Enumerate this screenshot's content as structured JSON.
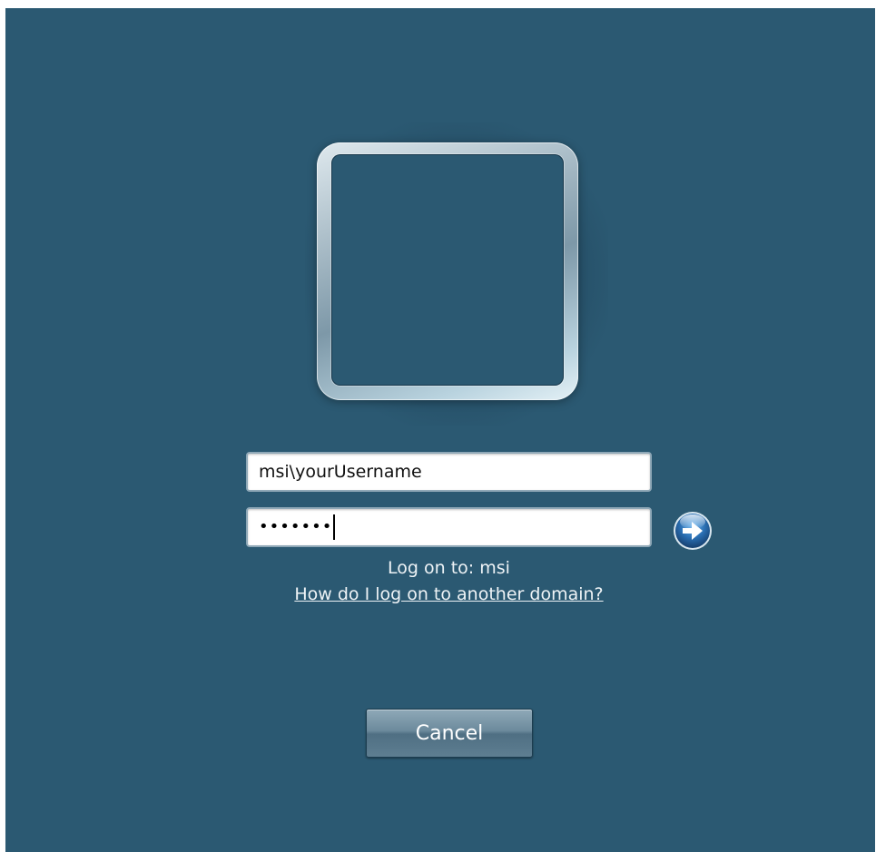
{
  "login": {
    "username_value": "msi\\yourUsername",
    "password_mask": "•••••••",
    "logon_to_text": "Log on to: msi",
    "other_domain_link": "How do I log on to another domain?",
    "cancel_label": "Cancel"
  },
  "icons": {
    "submit": "arrow-right-circle-icon",
    "user_tile": "user-picture-placeholder"
  },
  "colors": {
    "background": "#2b5972",
    "submit_button": "#2a6fb3",
    "text": "#eef3f6"
  }
}
